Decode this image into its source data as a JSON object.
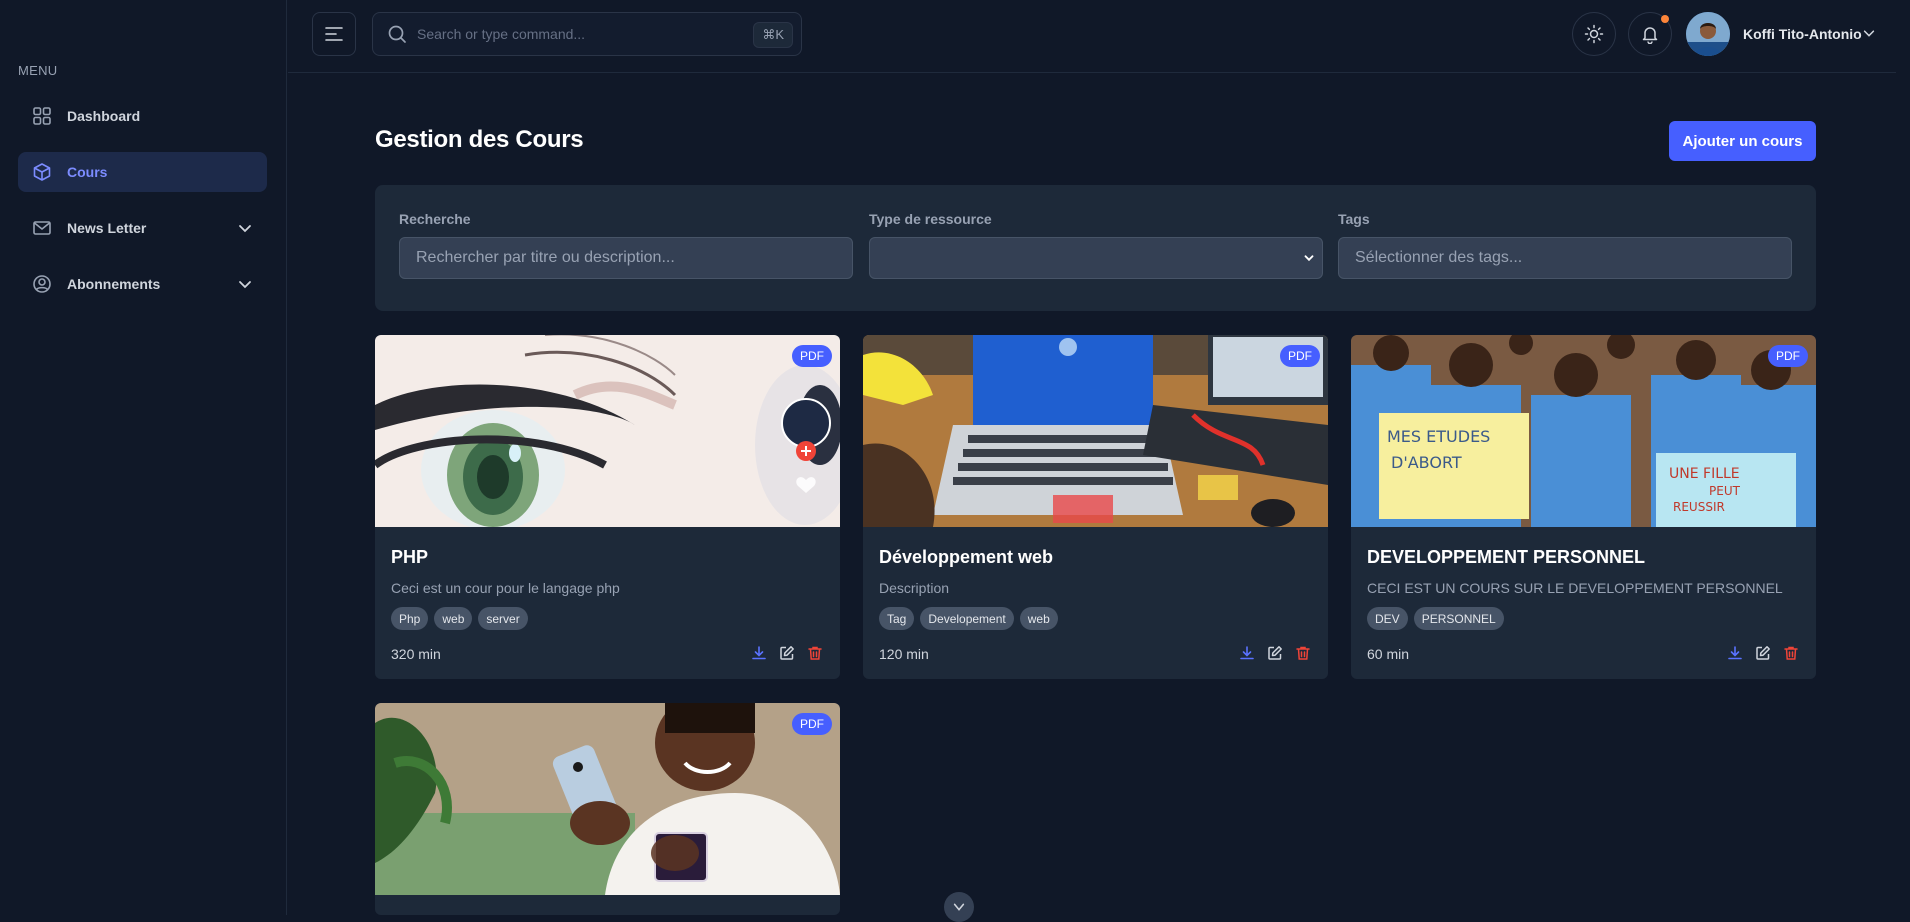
{
  "sidebar": {
    "menu_label": "MENU",
    "items": [
      {
        "label": "Dashboard",
        "icon": "grid-icon",
        "active": false
      },
      {
        "label": "Cours",
        "icon": "cube-icon",
        "active": true
      },
      {
        "label": "News Letter",
        "icon": "mail-icon",
        "has_submenu": true
      },
      {
        "label": "Abonnements",
        "icon": "user-circle-icon",
        "has_submenu": true
      }
    ]
  },
  "header": {
    "search_placeholder": "Search or type command...",
    "search_shortcut": "⌘K",
    "user_name": "Koffi Tito-Antonio"
  },
  "main": {
    "title": "Gestion des Cours",
    "add_button": "Ajouter un cours",
    "filters": {
      "search_label": "Recherche",
      "search_placeholder": "Rechercher par titre ou description...",
      "type_label": "Type de ressource",
      "type_value": "",
      "tags_label": "Tags",
      "tags_placeholder": "Sélectionner des tags..."
    },
    "courses": [
      {
        "title": "PHP",
        "description": "Ceci est un cour pour le langage php",
        "tags": [
          "Php",
          "web",
          "server"
        ],
        "duration": "320 min",
        "badge": "PDF"
      },
      {
        "title": "Développement web",
        "description": "Description",
        "tags": [
          "Tag",
          "Developement",
          "web"
        ],
        "duration": "120 min",
        "badge": "PDF"
      },
      {
        "title": "DEVELOPPEMENT PERSONNEL",
        "description": "CECI EST UN COURS SUR LE DEVELOPPEMENT PERSONNEL",
        "tags": [
          "DEV",
          "PERSONNEL"
        ],
        "duration": "60 min",
        "badge": "PDF"
      },
      {
        "title": "",
        "description": "",
        "tags": [],
        "duration": "",
        "badge": "PDF"
      }
    ],
    "thumb_texts": {
      "sign1_line1": "MES ETUDES",
      "sign1_line2": "D'ABORT",
      "sign2_line1": "UNE FILLE",
      "sign2_line2": "PEUT",
      "sign2_line3": "REUSSIR"
    }
  },
  "colors": {
    "background": "#101828",
    "panel": "#1d2939",
    "accent": "#465fff",
    "danger": "#f04438",
    "notification": "#fd853a"
  }
}
